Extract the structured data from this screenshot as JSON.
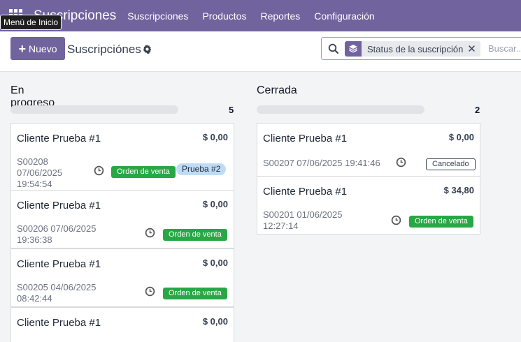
{
  "navbar": {
    "brand": "Suscripciones",
    "menu": [
      "Suscripciones",
      "Productos",
      "Reportes",
      "Configuración"
    ],
    "apps_icon": "apps-grid-icon",
    "tooltip": "Menú de Inicio",
    "color": "#71639e"
  },
  "control": {
    "new_label": "Nuevo",
    "title": "Suscripciónes",
    "search": {
      "facet_label": "Status de la suscripción",
      "placeholder": "Buscar..."
    }
  },
  "columns": [
    {
      "title": "En progreso",
      "count": "5",
      "cards": [
        {
          "customer": "Cliente Prueba #1",
          "amount": "$ 0,00",
          "ref": "S00208",
          "date": "07/06/2025",
          "time": "19:54:54",
          "tags": [
            "Orden de venta",
            "Prueba #2"
          ]
        },
        {
          "customer": "Cliente Prueba #1",
          "amount": "$ 0,00",
          "ref": "S00206 07/06/2025",
          "time": "19:36:38",
          "tags": [
            "Orden de venta"
          ]
        },
        {
          "customer": "Cliente Prueba #1",
          "amount": "$ 0,00",
          "ref": "S00205 04/06/2025",
          "time": "08:42:44",
          "tags": [
            "Orden de venta"
          ]
        },
        {
          "customer": "Cliente Prueba #1",
          "amount": "$ 0,00"
        }
      ]
    },
    {
      "title": "Cerrada",
      "count": "2",
      "cards": [
        {
          "customer": "Cliente Prueba #1",
          "amount": "$ 0,00",
          "ref": "S00207 07/06/2025 19:41:46",
          "tags": [
            "Cancelado"
          ]
        },
        {
          "customer": "Cliente Prueba #1",
          "amount": "$ 34,80",
          "ref": "S00201 01/06/2025",
          "time": "12:27:14",
          "tags": [
            "Orden de venta"
          ]
        }
      ]
    }
  ]
}
